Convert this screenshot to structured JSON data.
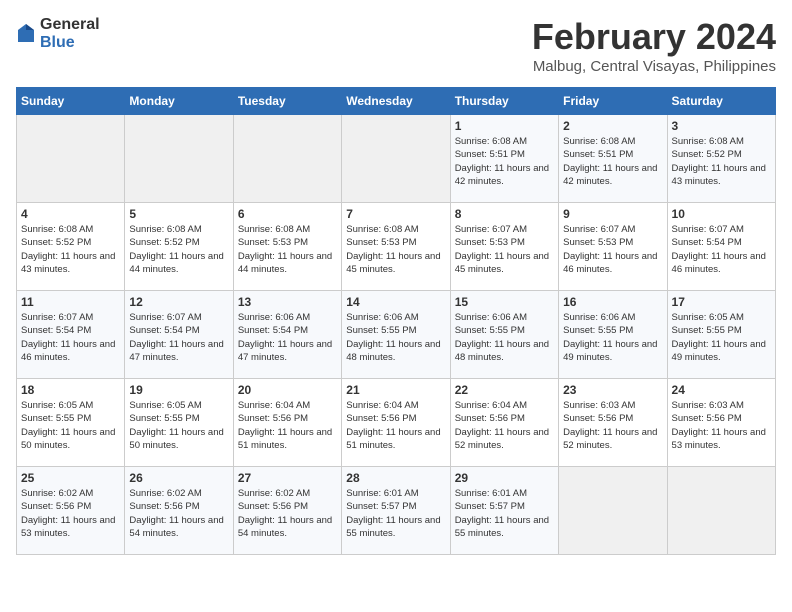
{
  "logo": {
    "general": "General",
    "blue": "Blue"
  },
  "title": "February 2024",
  "subtitle": "Malbug, Central Visayas, Philippines",
  "days_header": [
    "Sunday",
    "Monday",
    "Tuesday",
    "Wednesday",
    "Thursday",
    "Friday",
    "Saturday"
  ],
  "weeks": [
    [
      {
        "day": "",
        "info": ""
      },
      {
        "day": "",
        "info": ""
      },
      {
        "day": "",
        "info": ""
      },
      {
        "day": "",
        "info": ""
      },
      {
        "day": "1",
        "info": "Sunrise: 6:08 AM\nSunset: 5:51 PM\nDaylight: 11 hours and 42 minutes."
      },
      {
        "day": "2",
        "info": "Sunrise: 6:08 AM\nSunset: 5:51 PM\nDaylight: 11 hours and 42 minutes."
      },
      {
        "day": "3",
        "info": "Sunrise: 6:08 AM\nSunset: 5:52 PM\nDaylight: 11 hours and 43 minutes."
      }
    ],
    [
      {
        "day": "4",
        "info": "Sunrise: 6:08 AM\nSunset: 5:52 PM\nDaylight: 11 hours and 43 minutes."
      },
      {
        "day": "5",
        "info": "Sunrise: 6:08 AM\nSunset: 5:52 PM\nDaylight: 11 hours and 44 minutes."
      },
      {
        "day": "6",
        "info": "Sunrise: 6:08 AM\nSunset: 5:53 PM\nDaylight: 11 hours and 44 minutes."
      },
      {
        "day": "7",
        "info": "Sunrise: 6:08 AM\nSunset: 5:53 PM\nDaylight: 11 hours and 45 minutes."
      },
      {
        "day": "8",
        "info": "Sunrise: 6:07 AM\nSunset: 5:53 PM\nDaylight: 11 hours and 45 minutes."
      },
      {
        "day": "9",
        "info": "Sunrise: 6:07 AM\nSunset: 5:53 PM\nDaylight: 11 hours and 46 minutes."
      },
      {
        "day": "10",
        "info": "Sunrise: 6:07 AM\nSunset: 5:54 PM\nDaylight: 11 hours and 46 minutes."
      }
    ],
    [
      {
        "day": "11",
        "info": "Sunrise: 6:07 AM\nSunset: 5:54 PM\nDaylight: 11 hours and 46 minutes."
      },
      {
        "day": "12",
        "info": "Sunrise: 6:07 AM\nSunset: 5:54 PM\nDaylight: 11 hours and 47 minutes."
      },
      {
        "day": "13",
        "info": "Sunrise: 6:06 AM\nSunset: 5:54 PM\nDaylight: 11 hours and 47 minutes."
      },
      {
        "day": "14",
        "info": "Sunrise: 6:06 AM\nSunset: 5:55 PM\nDaylight: 11 hours and 48 minutes."
      },
      {
        "day": "15",
        "info": "Sunrise: 6:06 AM\nSunset: 5:55 PM\nDaylight: 11 hours and 48 minutes."
      },
      {
        "day": "16",
        "info": "Sunrise: 6:06 AM\nSunset: 5:55 PM\nDaylight: 11 hours and 49 minutes."
      },
      {
        "day": "17",
        "info": "Sunrise: 6:05 AM\nSunset: 5:55 PM\nDaylight: 11 hours and 49 minutes."
      }
    ],
    [
      {
        "day": "18",
        "info": "Sunrise: 6:05 AM\nSunset: 5:55 PM\nDaylight: 11 hours and 50 minutes."
      },
      {
        "day": "19",
        "info": "Sunrise: 6:05 AM\nSunset: 5:55 PM\nDaylight: 11 hours and 50 minutes."
      },
      {
        "day": "20",
        "info": "Sunrise: 6:04 AM\nSunset: 5:56 PM\nDaylight: 11 hours and 51 minutes."
      },
      {
        "day": "21",
        "info": "Sunrise: 6:04 AM\nSunset: 5:56 PM\nDaylight: 11 hours and 51 minutes."
      },
      {
        "day": "22",
        "info": "Sunrise: 6:04 AM\nSunset: 5:56 PM\nDaylight: 11 hours and 52 minutes."
      },
      {
        "day": "23",
        "info": "Sunrise: 6:03 AM\nSunset: 5:56 PM\nDaylight: 11 hours and 52 minutes."
      },
      {
        "day": "24",
        "info": "Sunrise: 6:03 AM\nSunset: 5:56 PM\nDaylight: 11 hours and 53 minutes."
      }
    ],
    [
      {
        "day": "25",
        "info": "Sunrise: 6:02 AM\nSunset: 5:56 PM\nDaylight: 11 hours and 53 minutes."
      },
      {
        "day": "26",
        "info": "Sunrise: 6:02 AM\nSunset: 5:56 PM\nDaylight: 11 hours and 54 minutes."
      },
      {
        "day": "27",
        "info": "Sunrise: 6:02 AM\nSunset: 5:56 PM\nDaylight: 11 hours and 54 minutes."
      },
      {
        "day": "28",
        "info": "Sunrise: 6:01 AM\nSunset: 5:57 PM\nDaylight: 11 hours and 55 minutes."
      },
      {
        "day": "29",
        "info": "Sunrise: 6:01 AM\nSunset: 5:57 PM\nDaylight: 11 hours and 55 minutes."
      },
      {
        "day": "",
        "info": ""
      },
      {
        "day": "",
        "info": ""
      }
    ]
  ]
}
